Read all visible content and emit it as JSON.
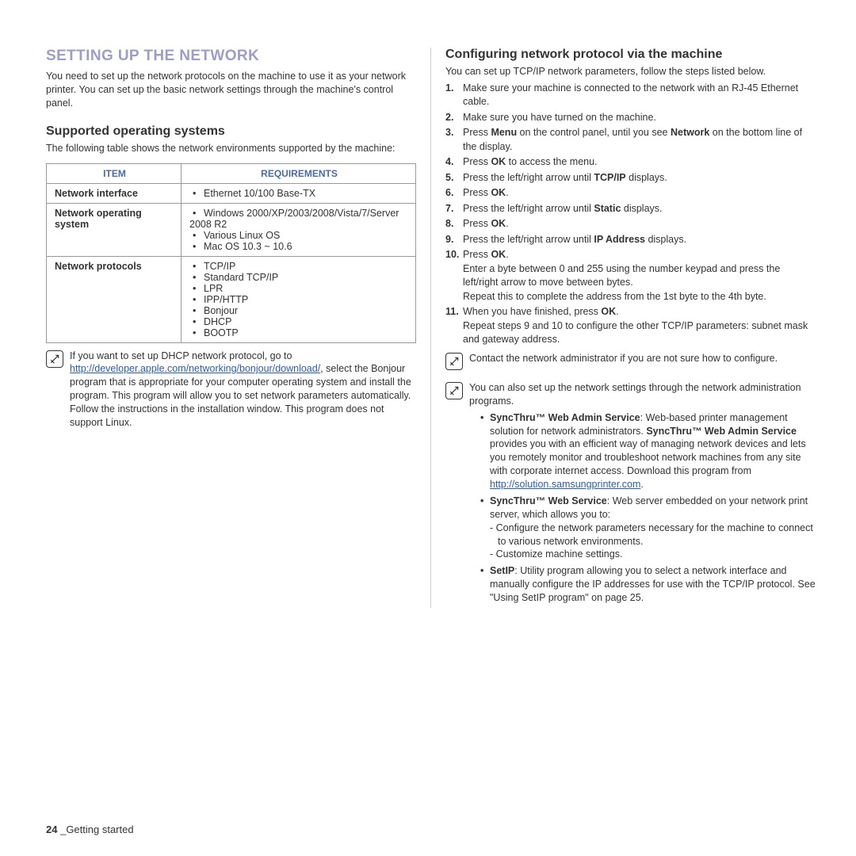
{
  "section_title": "SETTING UP THE NETWORK",
  "intro": "You need to set up the network protocols on the machine to use it as your network printer. You can set up the basic network settings through the machine's control panel.",
  "sub1": {
    "heading": "Supported operating systems",
    "lead": "The following table shows the network environments supported by the machine:",
    "table": {
      "h1": "ITEM",
      "h2": "REQUIREMENTS",
      "r1c1": "Network interface",
      "r1c2_1": "Ethernet 10/100 Base-TX",
      "r2c1": "Network operating system",
      "r2c2_1": "Windows 2000/XP/2003/2008/Vista/7/Server 2008 R2",
      "r2c2_2": "Various Linux OS",
      "r2c2_3": "Mac OS 10.3 ~ 10.6",
      "r3c1": "Network protocols",
      "r3c2_1": "TCP/IP",
      "r3c2_2": "Standard TCP/IP",
      "r3c2_3": "LPR",
      "r3c2_4": "IPP/HTTP",
      "r3c2_5": "Bonjour",
      "r3c2_6": "DHCP",
      "r3c2_7": "BOOTP"
    },
    "note1_pre": "If you want to set up DHCP network protocol, go to ",
    "note1_link": "http://developer.apple.com/networking/bonjour/download/",
    "note1_post": ", select the Bonjour program that is appropriate for your computer operating system and install the program. This program will allow you to set network parameters automatically. Follow the instructions in the installation window. This program does not support Linux."
  },
  "sub2": {
    "heading": "Configuring network protocol via the machine",
    "lead": "You can set up TCP/IP network parameters, follow the steps listed below.",
    "steps": {
      "s1": "Make sure your machine is connected to the network with an RJ-45 Ethernet cable.",
      "s2": "Make sure you have turned on the machine.",
      "s3a": "Press ",
      "s3b": "Menu",
      "s3c": " on the control panel, until you see ",
      "s3d": "Network",
      "s3e": " on the bottom line of the display.",
      "s4a": "Press ",
      "s4b": "OK",
      "s4c": " to access the menu.",
      "s5a": "Press the left/right arrow until ",
      "s5b": "TCP/IP",
      "s5c": " displays.",
      "s6a": "Press ",
      "s6b": "OK",
      "s6c": ".",
      "s7a": "Press the left/right arrow until ",
      "s7b": "Static",
      "s7c": " displays.",
      "s8a": "Press ",
      "s8b": "OK",
      "s8c": ".",
      "s9a": "Press the left/right arrow until ",
      "s9b": "IP Address",
      "s9c": " displays.",
      "s10a": "Press ",
      "s10b": "OK",
      "s10c": ".",
      "s10_sub1": "Enter a byte between 0 and 255 using the number keypad and press the left/right arrow  to move between bytes.",
      "s10_sub2": "Repeat this to complete the address from the 1st byte to the 4th byte.",
      "s11a": "When you have finished, press ",
      "s11b": "OK",
      "s11c": ".",
      "s11_sub": "Repeat steps 9 and 10 to configure the other TCP/IP parameters: subnet mask and gateway address."
    },
    "note2": "Contact the network administrator if you are not sure how to configure.",
    "note3_lead": "You can also set up the network settings through the network administration programs.",
    "bul1_a": "SyncThru™ Web Admin Service",
    "bul1_b": ": Web-based printer management solution for network administrators. ",
    "bul1_c": "SyncThru™ Web Admin Service",
    "bul1_d": " provides you with an efficient way of managing network devices and lets you remotely monitor and troubleshoot network machines from any site with corporate internet access. Download this program from ",
    "bul1_link": "http://solution.samsungprinter.com",
    "bul1_e": ".",
    "bul2_a": "SyncThru™ Web Service",
    "bul2_b": ": Web server embedded on your network print server, which allows you to:",
    "bul2_d1": "Configure the network parameters necessary for the machine to connect to various network environments.",
    "bul2_d2": "Customize machine settings.",
    "bul3_a": "SetIP",
    "bul3_b": ": Utility program allowing you to select a network interface and manually configure the IP addresses for use with the TCP/IP protocol. See \"Using SetIP program\" on page 25."
  },
  "footer_page": "24",
  "footer_sep": " _",
  "footer_text": "Getting started"
}
